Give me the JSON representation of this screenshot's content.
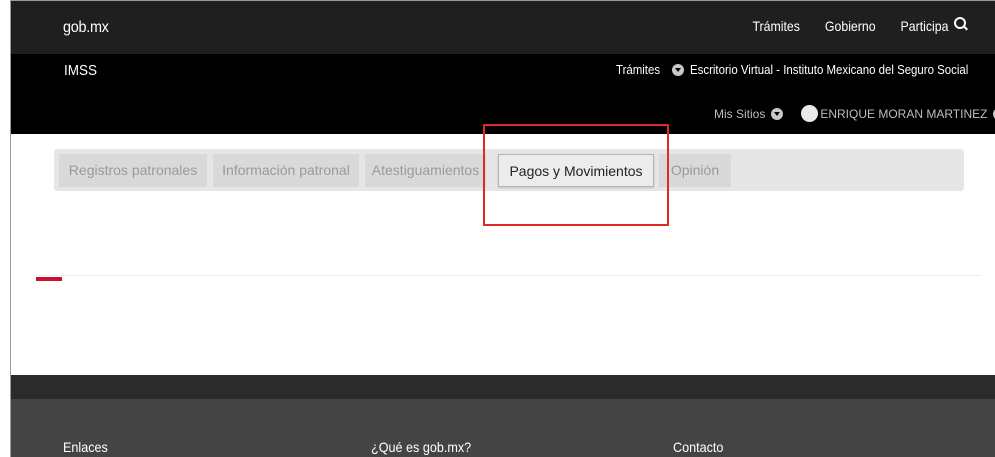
{
  "topbar": {
    "brand": "gob.mx",
    "nav": [
      "Trámites",
      "Gobierno",
      "Participa"
    ]
  },
  "subbar": {
    "title": "IMSS",
    "tramites": "Trámites",
    "escritorio": "Escritorio Virtual - Instituto Mexicano del Seguro Social",
    "mis_sitios": "Mis Sitios",
    "user": "ENRIQUE MORAN MARTINEZ"
  },
  "tabs": [
    {
      "label": "Registros patronales"
    },
    {
      "label": "Información patronal"
    },
    {
      "label": "Atestiguamientos"
    },
    {
      "label": "Pagos y Movimientos",
      "active": true
    },
    {
      "label": "Opinión"
    }
  ],
  "footer": {
    "enlaces": "Enlaces",
    "que_es": "¿Qué es gob.mx?",
    "contacto": "Contacto"
  },
  "colors": {
    "highlight": "#e02828",
    "accent_red": "#c4122f",
    "topbar": "#1f1f1f",
    "subbar": "#000000",
    "footer": "#444444"
  }
}
